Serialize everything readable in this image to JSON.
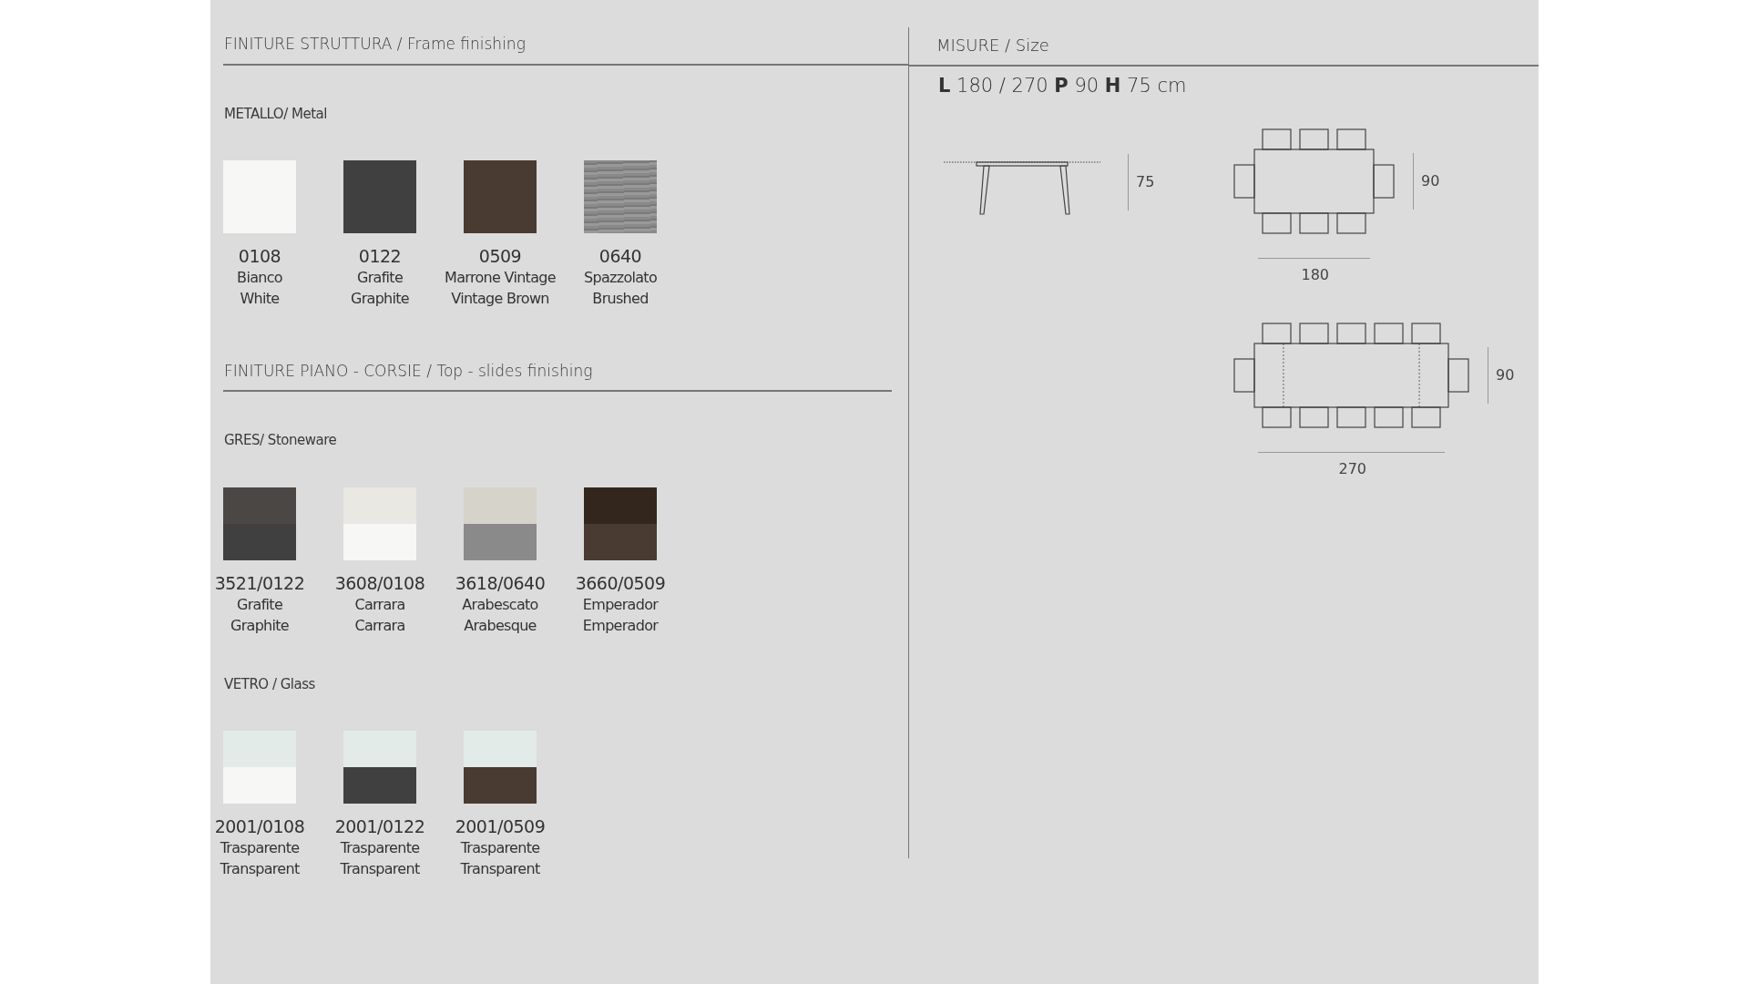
{
  "finishes": [
    {
      "heading": "FINITURE STRUTTURA / Frame finishing",
      "groups": [
        {
          "title": "METALLO/ Metal",
          "swatches": [
            {
              "kind": "solid",
              "color": "#f7f7f5",
              "code": "0108",
              "name_it": "Bianco",
              "name_en": "White"
            },
            {
              "kind": "solid",
              "color": "#404040",
              "code": "0122",
              "name_it": "Grafite",
              "name_en": "Graphite"
            },
            {
              "kind": "solid",
              "color": "#493b31",
              "code": "0509",
              "name_it": "Marrone Vintage",
              "name_en": "Vintage Brown"
            },
            {
              "kind": "brushed",
              "color": "#8a8a8a",
              "code": "0640",
              "name_it": "Spazzolato",
              "name_en": "Brushed"
            }
          ]
        }
      ]
    },
    {
      "heading": "FINITURE PIANO - CORSIE / Top - slides finishing",
      "groups": [
        {
          "title": "GRES/ Stoneware",
          "swatches": [
            {
              "kind": "split",
              "layers": [
                {
                  "color": "#4a4744"
                },
                {
                  "color": "#404040"
                }
              ],
              "code": "3521/0122",
              "name_it": "Grafite",
              "name_en": "Graphite"
            },
            {
              "kind": "split",
              "layers": [
                {
                  "color": "#e9e8e3"
                },
                {
                  "color": "#f7f7f5"
                }
              ],
              "code": "3608/0108",
              "name_it": "Carrara",
              "name_en": "Carrara"
            },
            {
              "kind": "split",
              "layers": [
                {
                  "color": "#d6d3ca"
                },
                {
                  "color": "#8a8a8a"
                }
              ],
              "code": "3618/0640",
              "name_it": "Arabescato",
              "name_en": "Arabesque"
            },
            {
              "kind": "split",
              "layers": [
                {
                  "color": "#33261c"
                },
                {
                  "color": "#493b31"
                }
              ],
              "code": "3660/0509",
              "name_it": "Emperador",
              "name_en": "Emperador"
            }
          ]
        },
        {
          "title": "VETRO / Glass",
          "swatches": [
            {
              "kind": "split",
              "layers": [
                {
                  "color": "#e3ebe8"
                },
                {
                  "color": "#f7f7f5"
                }
              ],
              "code": "2001/0108",
              "name_it": "Trasparente",
              "name_en": "Transparent"
            },
            {
              "kind": "split",
              "layers": [
                {
                  "color": "#e3ebe8"
                },
                {
                  "color": "#404040"
                }
              ],
              "code": "2001/0122",
              "name_it": "Trasparente",
              "name_en": "Transparent"
            },
            {
              "kind": "split",
              "layers": [
                {
                  "color": "#e3ebe8"
                },
                {
                  "color": "#493b31"
                }
              ],
              "code": "2001/0509",
              "name_it": "Trasparente",
              "name_en": "Transparent"
            }
          ]
        }
      ]
    }
  ],
  "size": {
    "heading": "MISURE / Size",
    "dimensions": "**L** 180 / 270 **P** 90 **H** 75 cm",
    "side_view": {
      "height_label": "75"
    },
    "plans": [
      {
        "extended": false,
        "depth_label": "90",
        "length_label": "180"
      },
      {
        "extended": true,
        "depth_label": "90",
        "length_label": "270"
      }
    ]
  }
}
